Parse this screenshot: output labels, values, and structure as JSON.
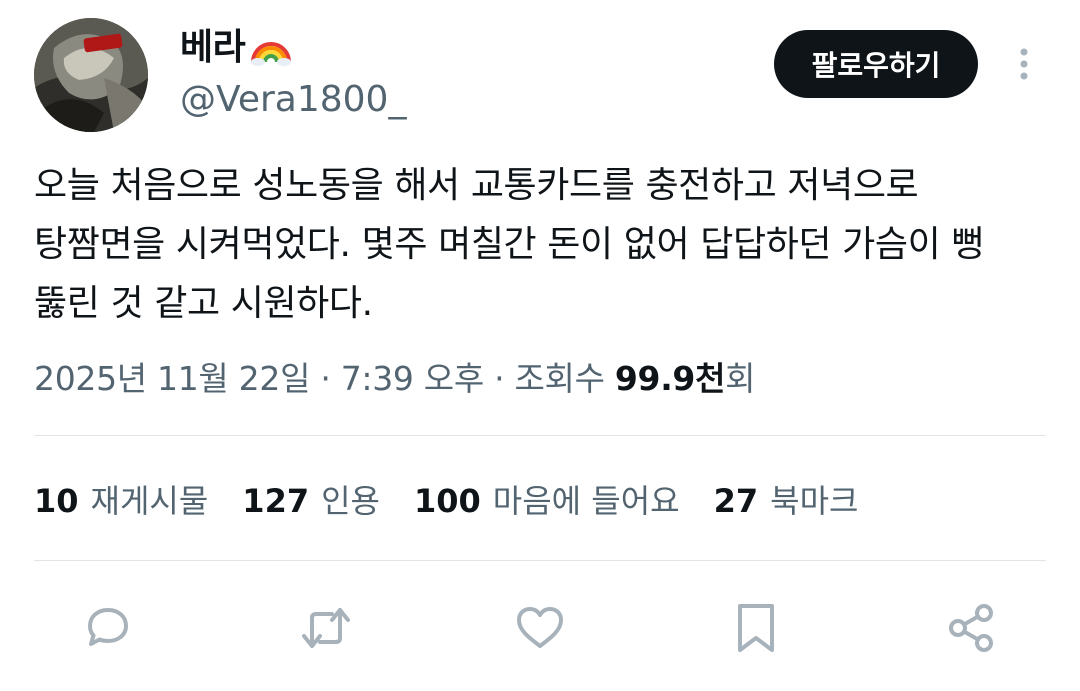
{
  "user": {
    "display_name": "베라",
    "display_name_emoji_icon": "rainbow-icon",
    "handle": "@Vera1800_",
    "avatar_icon": "avatar-image"
  },
  "header": {
    "follow_label": "팔로우하기",
    "more_icon": "more-vertical-icon"
  },
  "tweet": {
    "text": "오늘 처음으로 성노동을 해서 교통카드를 충전하고 저녁으로\n탕짬면을 시켜먹었다. 몇주 며칠간 돈이 없어 답답하던 가슴이 뻥\n뚫린 것 같고 시원하다."
  },
  "meta": {
    "date": "2025년 11월 22일",
    "sep1": " · ",
    "time": "7:39 오후",
    "sep2": " · ",
    "views_label": "조회수 ",
    "views_value": "99.9천",
    "views_suffix": "회"
  },
  "stats": [
    {
      "value": "10",
      "label": "재게시물"
    },
    {
      "value": "127",
      "label": "인용"
    },
    {
      "value": "100",
      "label": "마음에 들어요"
    },
    {
      "value": "27",
      "label": "북마크"
    }
  ],
  "actions": [
    {
      "icon": "reply-icon"
    },
    {
      "icon": "repost-icon"
    },
    {
      "icon": "like-icon"
    },
    {
      "icon": "bookmark-icon"
    },
    {
      "icon": "share-icon"
    }
  ],
  "colors": {
    "text": "#0f1419",
    "secondary": "#536471",
    "divider": "#e1e5e8",
    "action_icon": "#a7b2bb",
    "button_bg": "#0f1419"
  }
}
